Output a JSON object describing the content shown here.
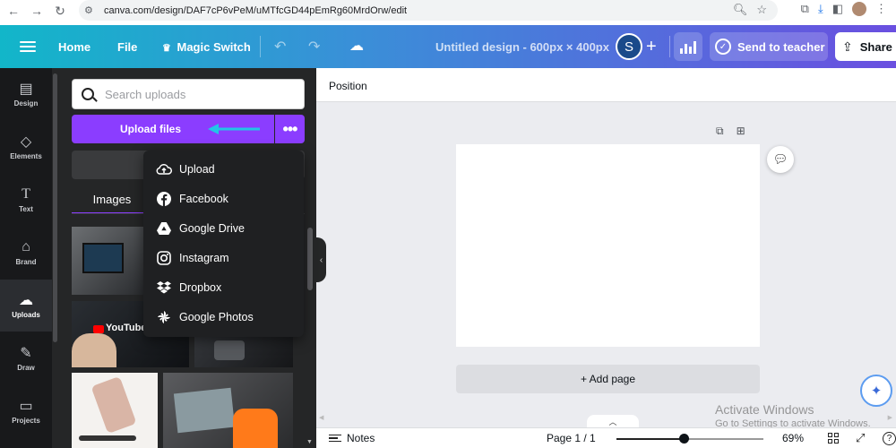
{
  "browser": {
    "url": "canva.com/design/DAF7cP6vPeM/uMTfcGD44pEmRg60MrdOrw/edit"
  },
  "header": {
    "home": "Home",
    "file": "File",
    "magic_switch": "Magic Switch",
    "design_title": "Untitled design - 600px × 400px",
    "avatar_initial": "S",
    "send_to_teacher": "Send to teacher",
    "share": "Share"
  },
  "rail": {
    "items": [
      {
        "label": "Design",
        "icon": "layout-icon"
      },
      {
        "label": "Elements",
        "icon": "shapes-icon"
      },
      {
        "label": "Text",
        "icon": "text-icon"
      },
      {
        "label": "Brand",
        "icon": "brand-icon"
      },
      {
        "label": "Uploads",
        "icon": "upload-cloud-icon",
        "active": true
      },
      {
        "label": "Draw",
        "icon": "pen-icon"
      },
      {
        "label": "Projects",
        "icon": "folder-icon"
      }
    ]
  },
  "panel": {
    "search_placeholder": "Search uploads",
    "upload_button": "Upload files",
    "tab_images": "Images"
  },
  "menu": {
    "items": [
      {
        "label": "Upload",
        "icon": "cloud-upload-icon"
      },
      {
        "label": "Facebook",
        "icon": "facebook-icon"
      },
      {
        "label": "Google Drive",
        "icon": "google-drive-icon"
      },
      {
        "label": "Instagram",
        "icon": "instagram-icon"
      },
      {
        "label": "Dropbox",
        "icon": "dropbox-icon"
      },
      {
        "label": "Google Photos",
        "icon": "google-photos-icon"
      }
    ]
  },
  "thumbnails": {
    "youtube_text": "YouTube"
  },
  "editor": {
    "position": "Position",
    "add_page": "+ Add page"
  },
  "watermark": {
    "title": "Activate Windows",
    "subtitle": "Go to Settings to activate Windows."
  },
  "footer": {
    "notes": "Notes",
    "page_count": "Page 1 / 1",
    "zoom": "69%",
    "zoom_fraction": 0.46
  },
  "colors": {
    "brand_purple": "#8b3dff",
    "header_gradient_start": "#12b6c9",
    "header_gradient_end": "#6a4fe0",
    "rail_bg": "#18191b",
    "panel_bg": "#252627",
    "arrow_annotation": "#22c5e6"
  }
}
